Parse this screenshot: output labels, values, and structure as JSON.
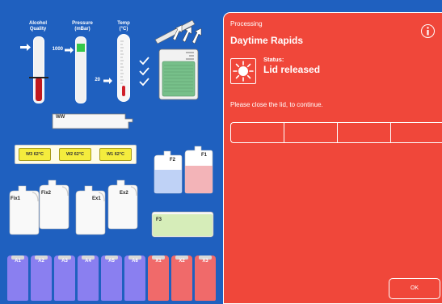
{
  "gauges": {
    "alcohol_label": "Alcohol\nQuality",
    "pressure_label": "Pressure\n(mBar)",
    "temp_label": "Temp\n(°C)",
    "pressure_value": "1000",
    "temp_value": "20",
    "alcohol_level": 0.38,
    "pressure_level": 0.09,
    "temp_level": 0.18
  },
  "wax_bath": {
    "label": "WW"
  },
  "wax_stations": [
    {
      "label": "W3  62°C"
    },
    {
      "label": "W2  62°C"
    },
    {
      "label": "W1  62°C"
    }
  ],
  "fixatives": [
    "Fix1",
    "Fix2"
  ],
  "exchanges": [
    "Ex1",
    "Ex2"
  ],
  "formalin": [
    "F2",
    "F1",
    "F3"
  ],
  "reagents": [
    "A1",
    "A2",
    "A3",
    "A4",
    "A5",
    "A6",
    "X1",
    "X2",
    "X3"
  ],
  "colors": {
    "background": "#1f60bf",
    "panel": "#f0473a",
    "wax": "#f4ec3d",
    "alcohol_bottle": "#8a7ff0",
    "xylene_bottle": "#f06a6a",
    "formalin_blue": "#bfd2f6",
    "formalin_pink": "#f3b4b8",
    "formalin_green": "#d6edb9",
    "retort_fill": "#77c08a"
  },
  "panel": {
    "header": "Processing",
    "protocol_name": "Daytime Rapids",
    "status_label": "Status:",
    "status_value": "Lid released",
    "message": "Please close the lid, to continue.",
    "ok_label": "OK",
    "info_icon": "info-icon",
    "status_icon": "sun-icon"
  }
}
